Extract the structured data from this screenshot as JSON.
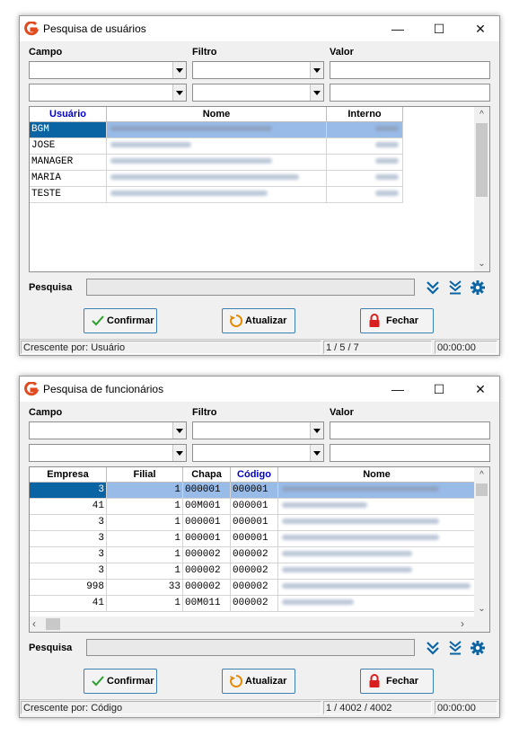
{
  "win1": {
    "title": "Pesquisa de usuários",
    "labels": {
      "campo": "Campo",
      "filtro": "Filtro",
      "valor": "Valor"
    },
    "columns": [
      "Usuário",
      "Nome",
      "Interno"
    ],
    "rows": [
      "BGM",
      "JOSE",
      "MANAGER",
      "MARIA",
      "TESTE"
    ],
    "selected_row": 0,
    "pesquisa_label": "Pesquisa",
    "buttons": {
      "confirmar": "Confirmar",
      "atualizar": "Atualizar",
      "fechar": "Fechar"
    },
    "status": {
      "order": "Crescente por: Usuário",
      "count": "1 / 5 / 7",
      "time": "00:00:00"
    }
  },
  "win2": {
    "title": "Pesquisa de funcionários",
    "labels": {
      "campo": "Campo",
      "filtro": "Filtro",
      "valor": "Valor"
    },
    "columns": [
      "Empresa",
      "Filial",
      "Chapa",
      "Código",
      "Nome"
    ],
    "rows": [
      [
        "3",
        "1",
        "000001",
        "000001"
      ],
      [
        "41",
        "1",
        "00M001",
        "000001"
      ],
      [
        "3",
        "1",
        "000001",
        "000001"
      ],
      [
        "3",
        "1",
        "000001",
        "000001"
      ],
      [
        "3",
        "1",
        "000002",
        "000002"
      ],
      [
        "3",
        "1",
        "000002",
        "000002"
      ],
      [
        "998",
        "33",
        "000002",
        "000002"
      ],
      [
        "41",
        "1",
        "00M011",
        "000002"
      ]
    ],
    "selected_row": 0,
    "pesquisa_label": "Pesquisa",
    "buttons": {
      "confirmar": "Confirmar",
      "atualizar": "Atualizar",
      "fechar": "Fechar"
    },
    "status": {
      "order": "Crescente por: Código",
      "count": "1 / 4002 / 4002",
      "time": "00:00:00"
    }
  },
  "window_controls": {
    "minimize": "—",
    "maximize": "☐",
    "close": "✕"
  },
  "colors": {
    "accent": "#0a64a4",
    "selection": "#99bbe8",
    "sort_column": "#0000c8",
    "fechar_icon": "#d81e1e",
    "confirm_icon": "#2aa02a",
    "refresh_icon": "#e58a00",
    "app_icon": "#e04a1f"
  }
}
